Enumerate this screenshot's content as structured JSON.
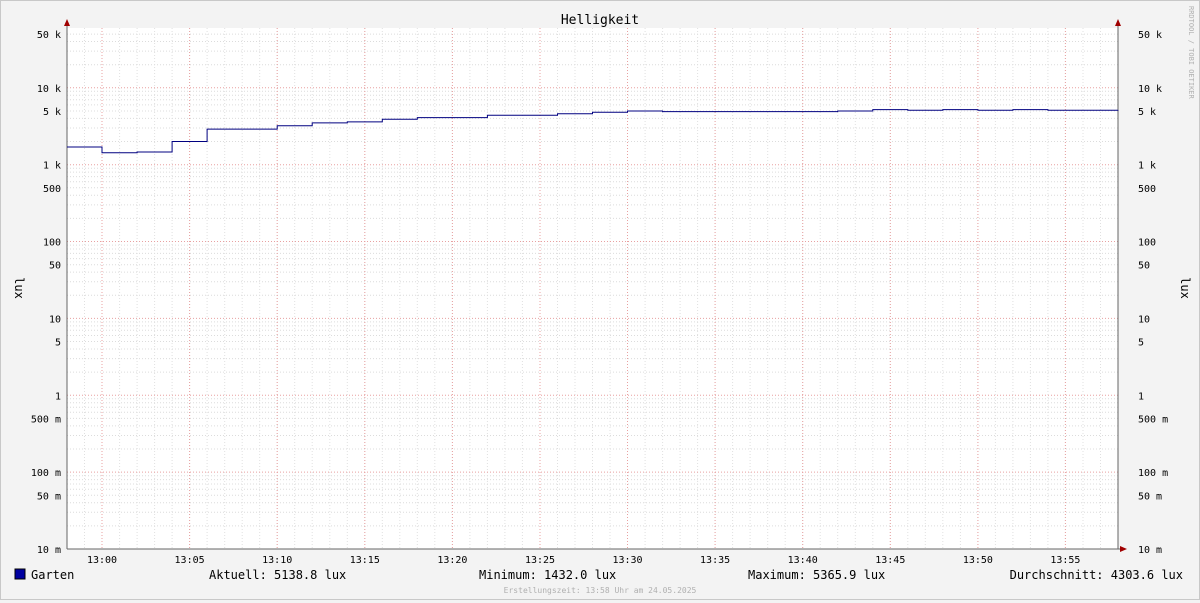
{
  "chart_data": {
    "type": "line",
    "title": "Helligkeit",
    "ylabel": "lux",
    "ylabel_right": "lux",
    "y_scale": "log",
    "ylim": [
      0.01,
      60000
    ],
    "y_ticks": [
      {
        "value": 50000,
        "label": "50 k"
      },
      {
        "value": 10000,
        "label": "10 k"
      },
      {
        "value": 5000,
        "label": "5 k"
      },
      {
        "value": 1000,
        "label": "1 k"
      },
      {
        "value": 500,
        "label": "500"
      },
      {
        "value": 100,
        "label": "100"
      },
      {
        "value": 50,
        "label": "50"
      },
      {
        "value": 10,
        "label": "10"
      },
      {
        "value": 5,
        "label": "5"
      },
      {
        "value": 1,
        "label": "1"
      },
      {
        "value": 0.5,
        "label": "500 m"
      },
      {
        "value": 0.1,
        "label": "100 m"
      },
      {
        "value": 0.05,
        "label": "50 m"
      },
      {
        "value": 0.01,
        "label": "10 m"
      }
    ],
    "x_ticks": [
      "13:00",
      "13:05",
      "13:10",
      "13:15",
      "13:20",
      "13:25",
      "13:30",
      "13:35",
      "13:40",
      "13:45",
      "13:50",
      "13:55"
    ],
    "xlim": [
      "12:58",
      "13:58"
    ],
    "grid": true,
    "series": [
      {
        "name": "Garten",
        "color": "#000080",
        "step": true,
        "x": [
          "12:58",
          "13:00",
          "13:02",
          "13:04",
          "13:06",
          "13:08",
          "13:10",
          "13:12",
          "13:14",
          "13:16",
          "13:18",
          "13:20",
          "13:22",
          "13:24",
          "13:26",
          "13:28",
          "13:30",
          "13:32",
          "13:34",
          "13:36",
          "13:38",
          "13:40",
          "13:42",
          "13:44",
          "13:46",
          "13:48",
          "13:50",
          "13:52",
          "13:54",
          "13:56",
          "13:58"
        ],
        "values": [
          1700,
          1432,
          1460,
          2000,
          2900,
          2900,
          3200,
          3500,
          3600,
          3900,
          4100,
          4100,
          4400,
          4400,
          4600,
          4800,
          5000,
          4900,
          4900,
          4900,
          4900,
          4900,
          5000,
          5200,
          5100,
          5200,
          5100,
          5200,
          5100,
          5100,
          5138.8
        ]
      }
    ]
  },
  "legend": {
    "series_name": "Garten",
    "color": "#0000a0",
    "aktuell": "Aktuell: 5138.8 lux",
    "minimum": "Minimum: 1432.0 lux",
    "maximum": "Maximum: 5365.9 lux",
    "durchschnitt": "Durchschnitt: 4303.6 lux"
  },
  "footer": "Erstellungszeit: 13:58 Uhr am 24.05.2025",
  "watermark": "RRDTOOL / TOBI OETIKER"
}
